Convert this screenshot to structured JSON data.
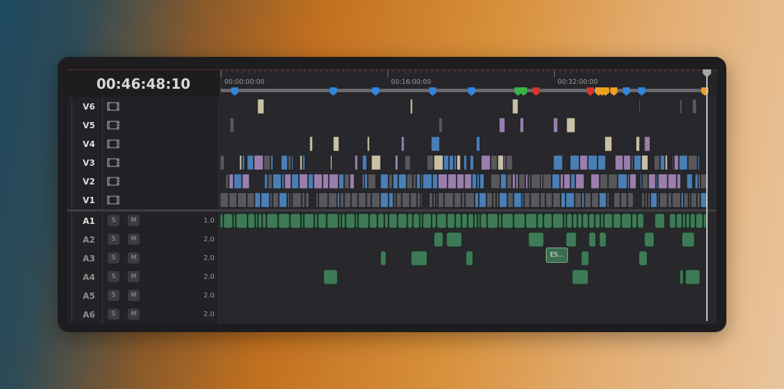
{
  "timecode": "00:46:48:10",
  "ruler": {
    "labels": [
      "00:00:00:00",
      "00:16:00:00",
      "00:32:00:00"
    ]
  },
  "video_tracks": [
    {
      "name": "V6",
      "icon": "film-icon"
    },
    {
      "name": "V5",
      "icon": "film-icon"
    },
    {
      "name": "V4",
      "icon": "film-icon"
    },
    {
      "name": "V3",
      "icon": "film-icon"
    },
    {
      "name": "V2",
      "icon": "film-icon"
    },
    {
      "name": "V1",
      "icon": "film-icon"
    }
  ],
  "audio_tracks": [
    {
      "name": "A1",
      "solo": "S",
      "mute": "M",
      "level": "1.0"
    },
    {
      "name": "A2",
      "solo": "S",
      "mute": "M",
      "level": "2.0"
    },
    {
      "name": "A3",
      "solo": "S",
      "mute": "M",
      "level": "2.0"
    },
    {
      "name": "A4",
      "solo": "S",
      "mute": "M",
      "level": "2.0"
    },
    {
      "name": "A5",
      "solo": "S",
      "mute": "M",
      "level": "2.0"
    },
    {
      "name": "A6",
      "solo": "S",
      "mute": "M",
      "level": "2.0"
    }
  ],
  "clip_label": "ES...",
  "colors": {
    "video_blue": "#4a7fb5",
    "video_purple": "#9a7fae",
    "video_beige": "#c9c1a6",
    "video_gray": "#58585c",
    "audio_green": "#3e7a56",
    "marker_blue": "#2f86e0",
    "marker_green": "#3bb34a",
    "marker_red": "#d9352a",
    "marker_orange": "#f0a020"
  }
}
